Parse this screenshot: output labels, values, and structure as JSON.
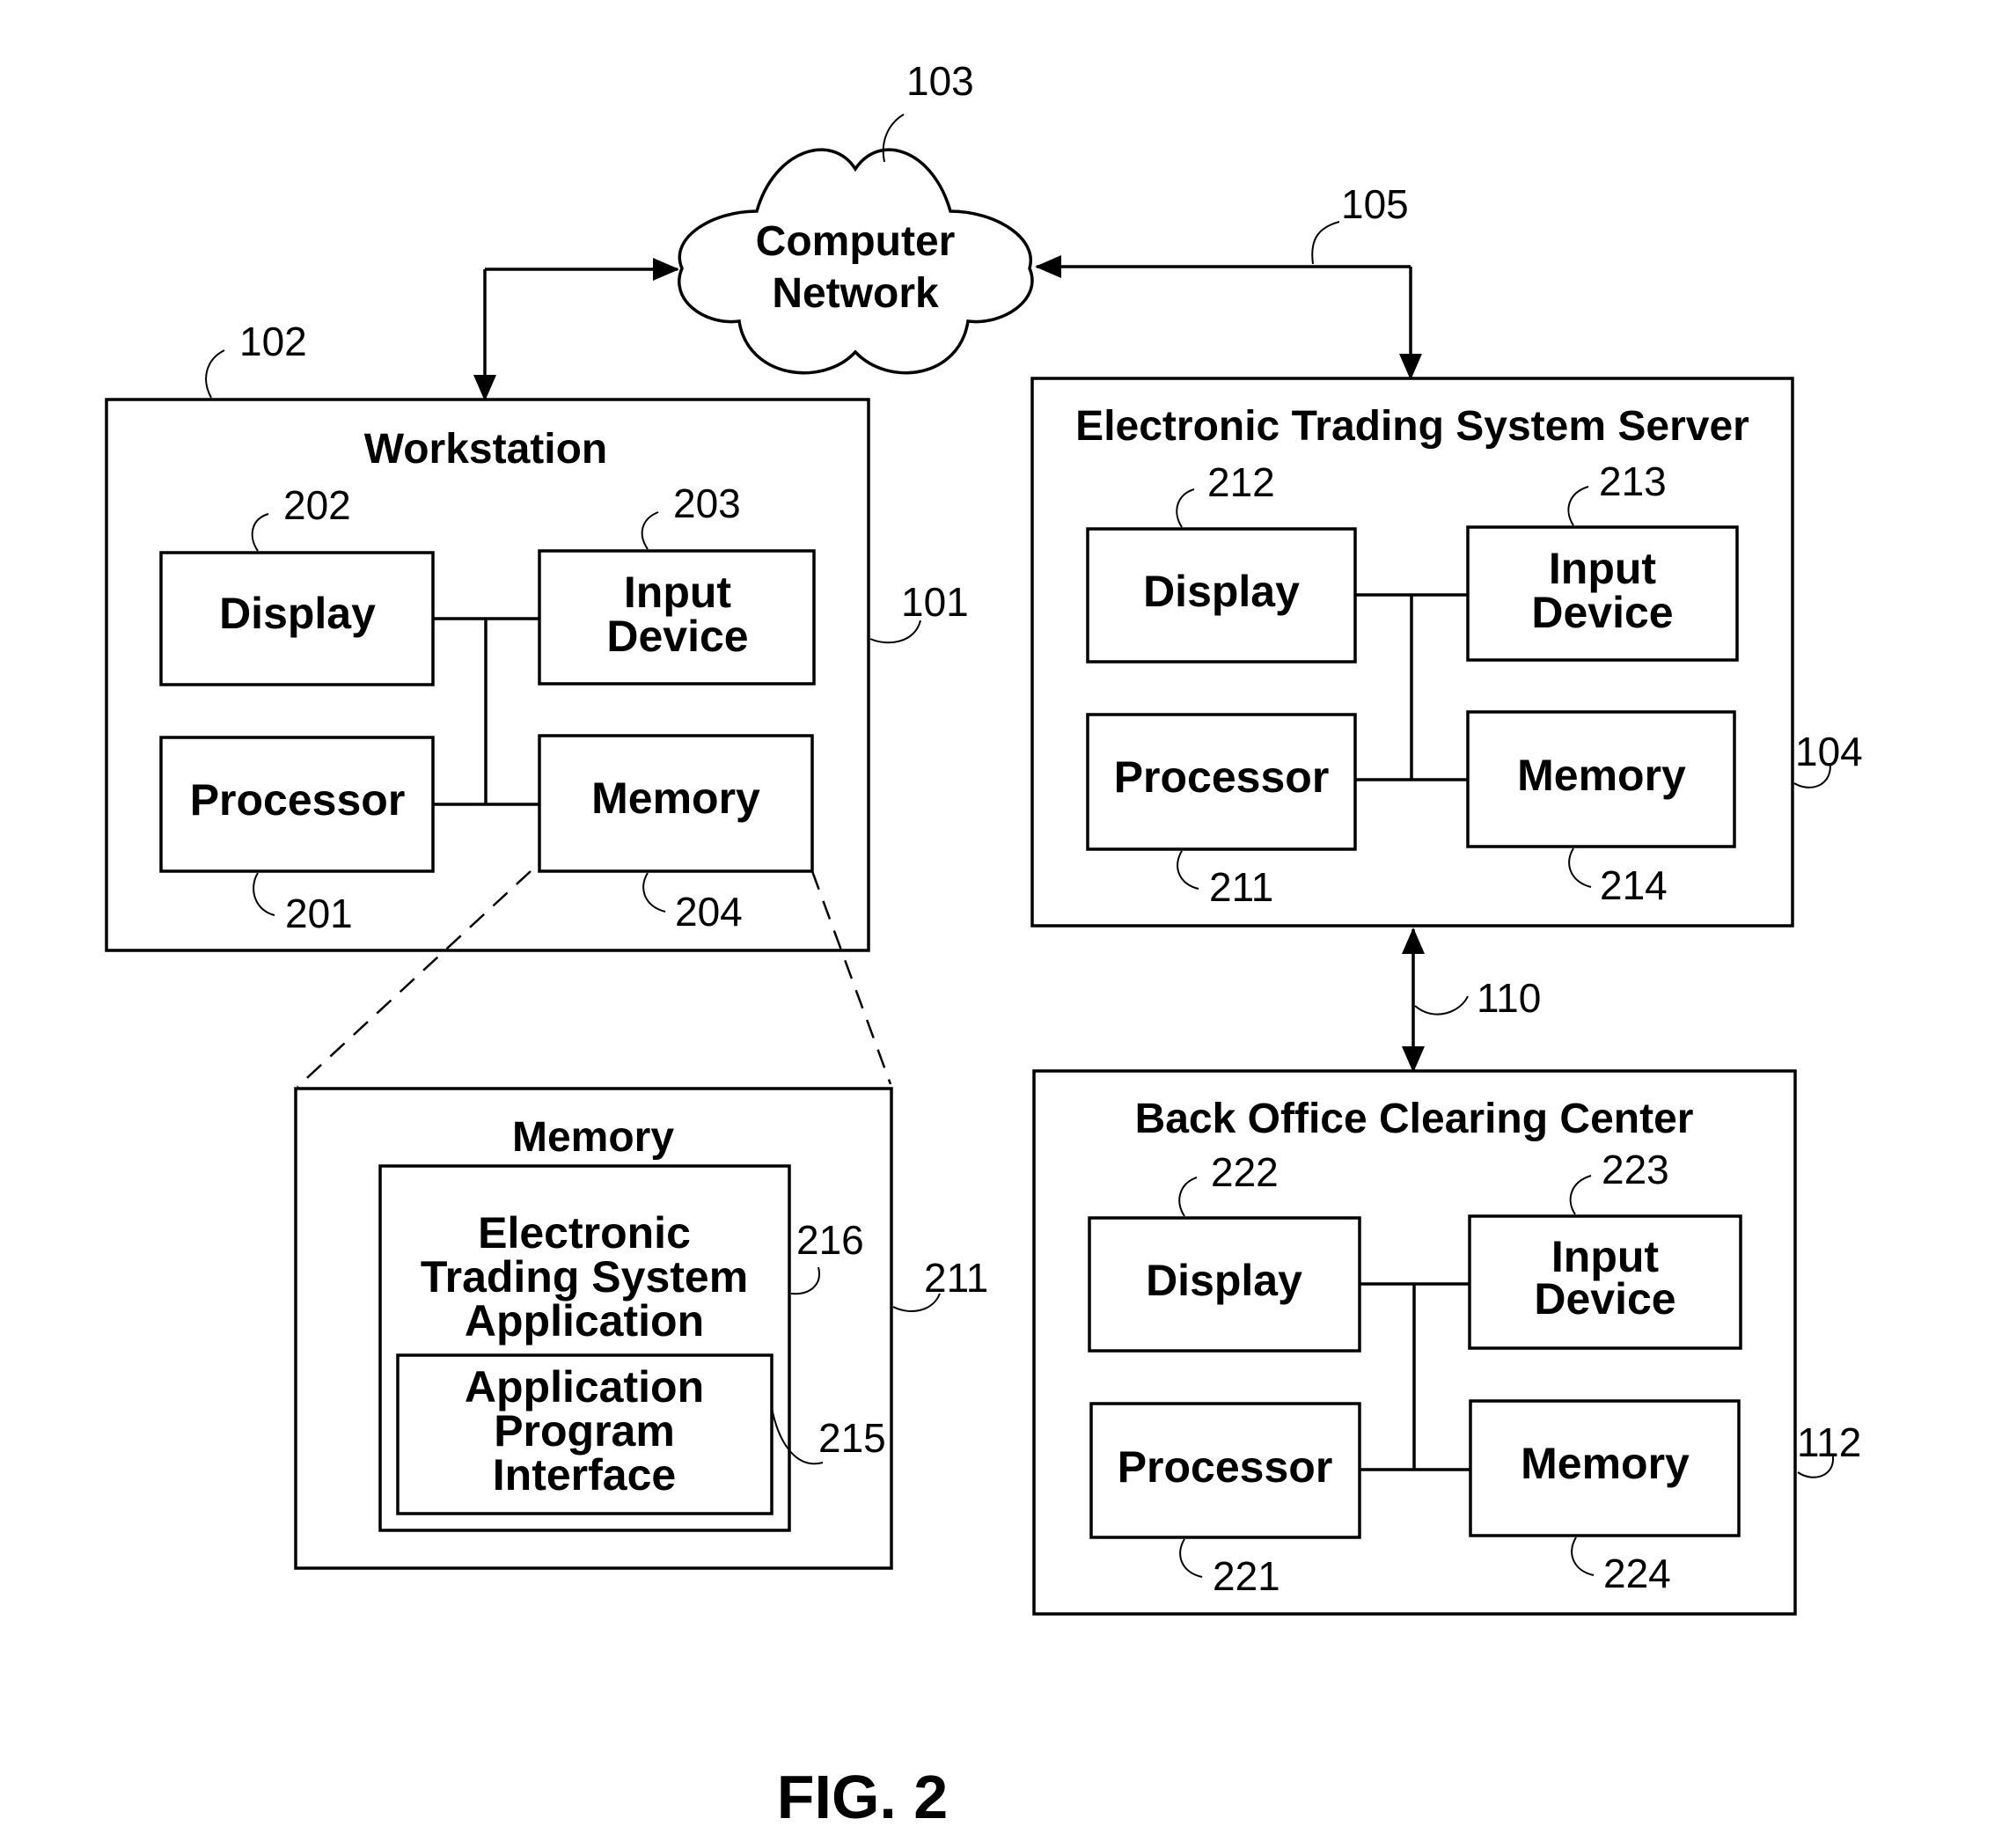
{
  "figure_label": "FIG. 2",
  "network": {
    "label_line1": "Computer",
    "label_line2": "Network",
    "ref": "103"
  },
  "links": {
    "network_to_server_ref": "105",
    "server_to_backoffice_ref": "110"
  },
  "workstation": {
    "title": "Workstation",
    "ref_box": "101",
    "ref_top": "102",
    "display": {
      "label": "Display",
      "ref": "202"
    },
    "input_device": {
      "label_line1": "Input",
      "label_line2": "Device",
      "ref": "203"
    },
    "processor": {
      "label": "Processor",
      "ref": "201"
    },
    "memory": {
      "label": "Memory",
      "ref": "204"
    }
  },
  "server": {
    "title": "Electronic Trading System Server",
    "ref_box": "104",
    "display": {
      "label": "Display",
      "ref": "212"
    },
    "input_device": {
      "label_line1": "Input",
      "label_line2": "Device",
      "ref": "213"
    },
    "processor": {
      "label": "Processor",
      "ref": "211"
    },
    "memory": {
      "label": "Memory",
      "ref": "214"
    }
  },
  "back_office": {
    "title": "Back Office Clearing Center",
    "ref_box": "112",
    "display": {
      "label": "Display",
      "ref": "222"
    },
    "input_device": {
      "label_line1": "Input",
      "label_line2": "Device",
      "ref": "223"
    },
    "processor": {
      "label": "Processor",
      "ref": "221"
    },
    "memory": {
      "label": "Memory",
      "ref": "224"
    }
  },
  "memory_detail": {
    "title": "Memory",
    "ref_box": "211",
    "application": {
      "label_line1": "Electronic",
      "label_line2": "Trading System",
      "label_line3": "Application",
      "ref": "216"
    },
    "api": {
      "label_line1": "Application",
      "label_line2": "Program",
      "label_line3": "Interface",
      "ref": "215"
    }
  }
}
